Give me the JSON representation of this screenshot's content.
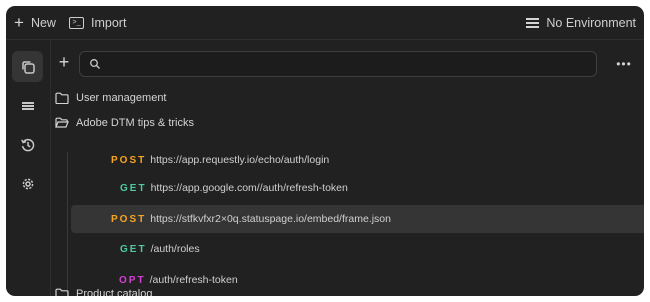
{
  "topbar": {
    "new_label": "New",
    "import_label": "Import",
    "environment_label": "No Environment"
  },
  "sidebar": {
    "items": [
      {
        "icon": "collections-icon",
        "active": true
      },
      {
        "icon": "list-icon",
        "active": false
      },
      {
        "icon": "history-icon",
        "active": false
      },
      {
        "icon": "settings-icon",
        "active": false
      }
    ]
  },
  "search": {
    "placeholder": "",
    "value": ""
  },
  "tree": {
    "folders": [
      {
        "name": "User management",
        "open": false
      },
      {
        "name": "Adobe DTM tips & tricks",
        "open": true
      },
      {
        "name": "Product catalog",
        "open": false
      }
    ],
    "requests": [
      {
        "method": "POST",
        "url": "https://app.requestly.io/echo/auth/login",
        "selected": false
      },
      {
        "method": "GET",
        "url": "https://app.google.com//auth/refresh-token",
        "selected": false
      },
      {
        "method": "POST",
        "url": "https://stfkvfxr2×0q.statuspage.io/embed/frame.json",
        "selected": true
      },
      {
        "method": "GET",
        "url": "/auth/roles",
        "selected": false
      },
      {
        "method": "OPT",
        "url": "/auth/refresh-token",
        "selected": false
      }
    ]
  },
  "colors": {
    "post": "#f5a524",
    "get": "#4ec9a0",
    "opt": "#d43fd4",
    "background": "#212121",
    "selected_row": "#353535"
  }
}
